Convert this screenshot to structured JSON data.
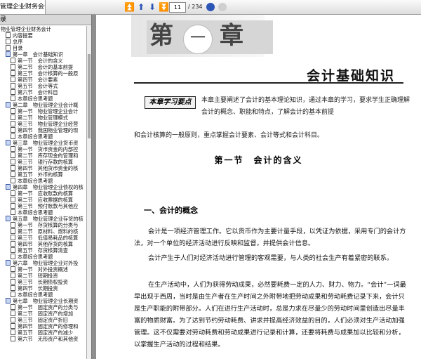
{
  "toolbar": {
    "document_tab": "管理企业财务会计)...",
    "page_current": "11",
    "page_total": "/ 234",
    "accent": "#2c56b5"
  },
  "sidebar": {
    "header": "录",
    "items": [
      {
        "label": "物业管理企业财务会计",
        "level": 0,
        "box": "none"
      },
      {
        "label": "内容提要",
        "level": 1,
        "box": "leaf"
      },
      {
        "label": "总序",
        "level": 1,
        "box": "leaf"
      },
      {
        "label": "目录",
        "level": 1,
        "box": "leaf"
      },
      {
        "label": "第一章　会计基础知识",
        "level": 1,
        "box": "open"
      },
      {
        "label": "第一节　会计的含义",
        "level": 2,
        "box": "leaf"
      },
      {
        "label": "第二节　会计的基本前提",
        "level": 2,
        "box": "leaf"
      },
      {
        "label": "第三节　会计核算的一般原",
        "level": 2,
        "box": "leaf"
      },
      {
        "label": "第四节　会计要素",
        "level": 2,
        "box": "leaf"
      },
      {
        "label": "第五节　会计等式",
        "level": 2,
        "box": "leaf"
      },
      {
        "label": "第六节　会计科目",
        "level": 2,
        "box": "leaf"
      },
      {
        "label": "本章综合思考题",
        "level": 2,
        "box": "leaf"
      },
      {
        "label": "第二章　物业管理企业会计概",
        "level": 1,
        "box": "open"
      },
      {
        "label": "第一节　物业管理企业会计",
        "level": 2,
        "box": "leaf"
      },
      {
        "label": "第二节　物业管理模式",
        "level": 2,
        "box": "leaf"
      },
      {
        "label": "第三节　物业管理企业经营",
        "level": 2,
        "box": "leaf"
      },
      {
        "label": "第四节　我国物业管理的现",
        "level": 2,
        "box": "leaf"
      },
      {
        "label": "本章综合思考题",
        "level": 2,
        "box": "leaf"
      },
      {
        "label": "第三章　物业管理企业货币资",
        "level": 1,
        "box": "open"
      },
      {
        "label": "第一节　货币资金的内部控",
        "level": 2,
        "box": "leaf"
      },
      {
        "label": "第二节　库存现金的管理和",
        "level": 2,
        "box": "leaf"
      },
      {
        "label": "第三节　银行存款的核算",
        "level": 2,
        "box": "leaf"
      },
      {
        "label": "第四节　其他货币资金的核",
        "level": 2,
        "box": "leaf"
      },
      {
        "label": "第五节　外币的核算",
        "level": 2,
        "box": "leaf"
      },
      {
        "label": "本章综合思考题",
        "level": 2,
        "box": "leaf"
      },
      {
        "label": "第四章　物业管理企业债权的核",
        "level": 1,
        "box": "open"
      },
      {
        "label": "第一节　应收账款的核算",
        "level": 2,
        "box": "leaf"
      },
      {
        "label": "第二节　应收票据的核算",
        "level": 2,
        "box": "leaf"
      },
      {
        "label": "第三节　预付账款与其他应",
        "level": 2,
        "box": "leaf"
      },
      {
        "label": "本章综合思考题",
        "level": 2,
        "box": "leaf"
      },
      {
        "label": "第五章　物业管理企业存货的核",
        "level": 1,
        "box": "open"
      },
      {
        "label": "第一节　存货核算的分类与",
        "level": 2,
        "box": "leaf"
      },
      {
        "label": "第二节　原材料、燃料的核",
        "level": 2,
        "box": "leaf"
      },
      {
        "label": "第三节　低值易耗品的核算",
        "level": 2,
        "box": "leaf"
      },
      {
        "label": "第四节　其他存货的核算",
        "level": 2,
        "box": "leaf"
      },
      {
        "label": "第五节　存货核算清查",
        "level": 2,
        "box": "leaf"
      },
      {
        "label": "本章综合思考题",
        "level": 2,
        "box": "leaf"
      },
      {
        "label": "第六章　物业管理企业对外投",
        "level": 1,
        "box": "open"
      },
      {
        "label": "第一节　对外投资概述",
        "level": 2,
        "box": "leaf"
      },
      {
        "label": "第二节　短期投资",
        "level": 2,
        "box": "leaf"
      },
      {
        "label": "第三节　长期债权投资",
        "level": 2,
        "box": "leaf"
      },
      {
        "label": "第四节　长期投资",
        "level": 2,
        "box": "leaf"
      },
      {
        "label": "本章综合思考题",
        "level": 2,
        "box": "leaf"
      },
      {
        "label": "第七章　物业管理企业长期资",
        "level": 1,
        "box": "open"
      },
      {
        "label": "第一节　固定资产的分类与",
        "level": 2,
        "box": "leaf"
      },
      {
        "label": "第二节　固定资产的增加",
        "level": 2,
        "box": "leaf"
      },
      {
        "label": "第三节　固定资产折旧",
        "level": 2,
        "box": "leaf"
      },
      {
        "label": "第四节　固定资产的修理和",
        "level": 2,
        "box": "leaf"
      },
      {
        "label": "第五节　固定资产的减少",
        "level": 2,
        "box": "leaf"
      },
      {
        "label": "第六节　无形资产和其他资",
        "level": 2,
        "box": "leaf"
      }
    ]
  },
  "page": {
    "chapter_di": "第",
    "chapter_num": "一",
    "chapter_zhang": "章",
    "chapter_title": "会计基础知识",
    "goal_badge": "本章学习要点",
    "intro_line1": "本章主要阐述了会计的基本理论知识，通过本章的学习，要求学生正确理解会计的概念、职能和特点，了解会计的基本前提",
    "intro_line2": "和会计核算的一般原则，重点掌握会计要素、会计等式和会计科目。",
    "section_title": "第一节　会计的含义",
    "sub_title": "一、会计的概念",
    "para1": "会计是一项经济管理工作。它以货币作为主要计量手段，以凭证为依据，采用专门的会计方法，对一个单位的经济活动进行反映和监督，并提供会计信息。",
    "para2": "会计产生于人们对经济活动进行管理的客观需要，与人类的社会生产有着紧密的联系。",
    "para3": "在生产活动中，人们为获得劳动成果，必然要耗费一定的人力、财力、物力。“会计”一词最早出现于西周，当时是由生产者在生产时间之外附带地把劳动成果和劳动耗费记录下来，会计只是生产职能的附带部分。人们在进行生产活动时，总是力求在尽量少的劳动时间里创造出尽量丰富的物质财富。为了达到节约劳动耗费、讲求并提高经济效益的目的，人们必须对生产活动加强管理。这不仅需要对劳动耗费和劳动成果进行记录和计算，还要将耗费与成果加以比较和分析，以掌握生产活动的过程和结果。"
  }
}
